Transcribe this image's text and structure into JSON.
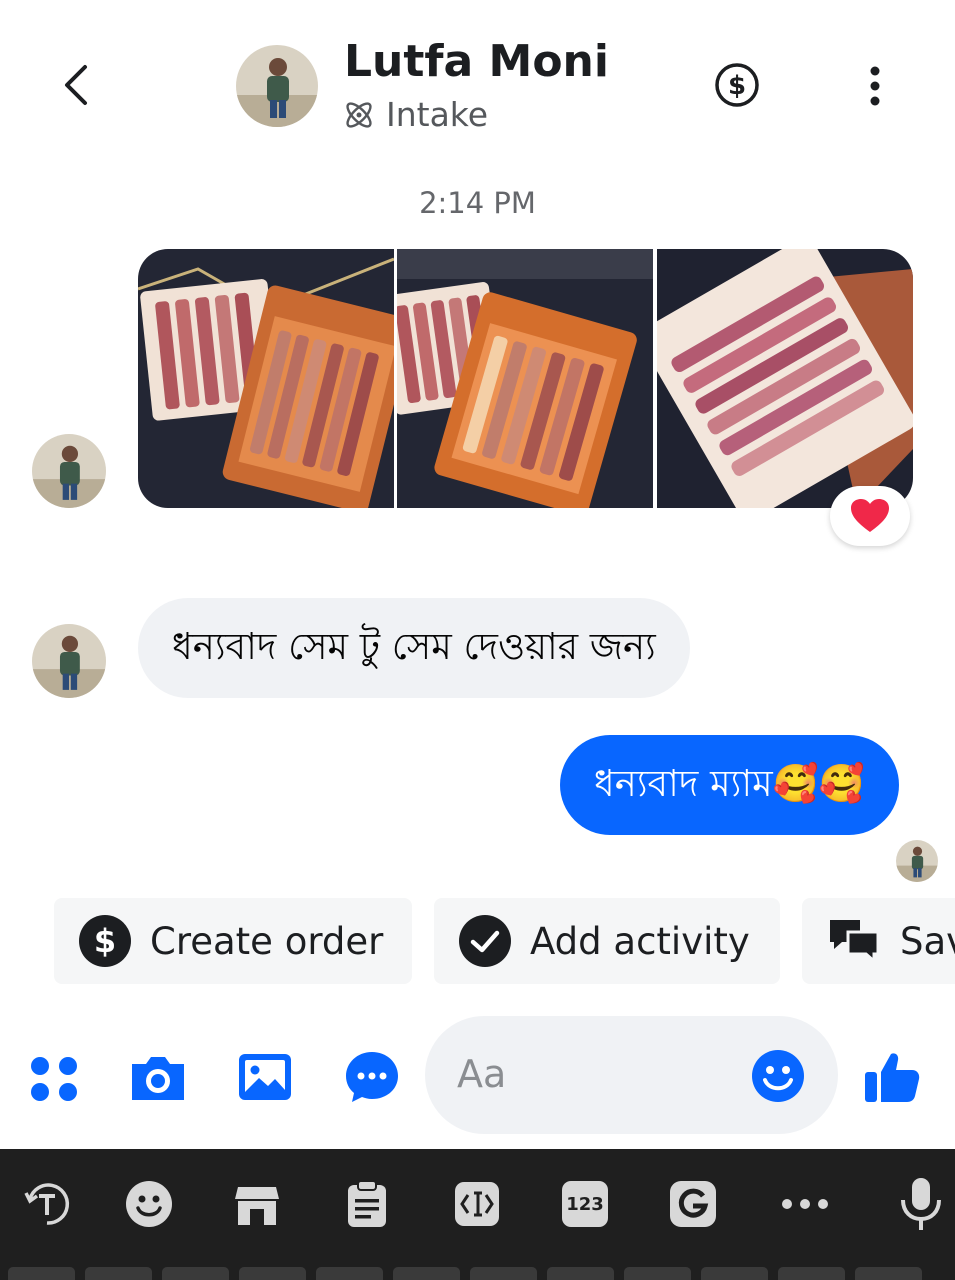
{
  "header": {
    "contact_name": "Lutfa Moni",
    "label": "Intake"
  },
  "conversation": {
    "timestamp": "2:14 PM",
    "photos": [
      "lipstick-set-photo-1",
      "lipstick-set-photo-2",
      "lipstick-set-photo-3"
    ],
    "reaction": "❤️",
    "incoming_message": "ধন্যবাদ সেম টু সেম দেওয়ার জন্য",
    "outgoing_message": "ধন্যবাদ ম্যাম🥰🥰"
  },
  "quick_actions": {
    "create_order": "Create order",
    "add_activity": "Add activity",
    "saved_replies": "Sav"
  },
  "composer": {
    "placeholder": "Aa"
  },
  "keyboard": {
    "numbers_label": "123"
  },
  "colors": {
    "accent": "#0866ff",
    "bubble_incoming": "#f0f2f5",
    "keyboard_bg": "#1f1f1f"
  }
}
